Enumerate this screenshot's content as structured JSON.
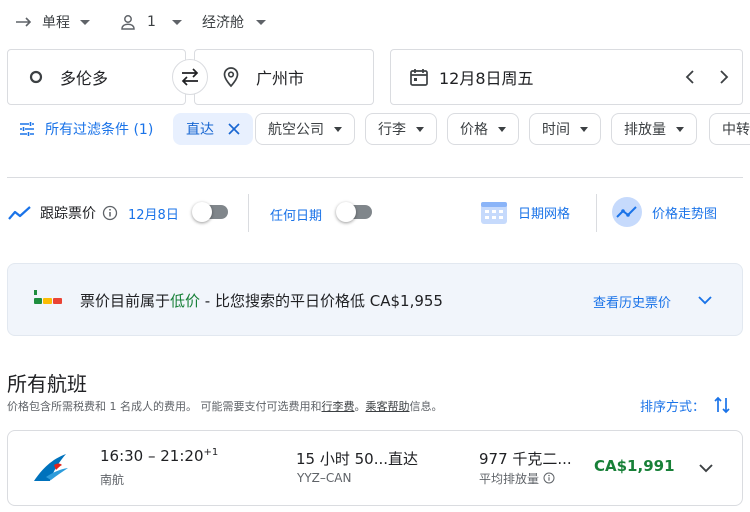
{
  "trip_options": {
    "trip_type": "单程",
    "passengers": "1",
    "cabin": "经济舱"
  },
  "search": {
    "origin": "多伦多",
    "destination": "广州市",
    "date": "12月8日周五"
  },
  "filters": {
    "all_filters": "所有过滤条件 (1)",
    "active_chip": "直达",
    "chips": [
      "航空公司",
      "行李",
      "价格",
      "时间",
      "排放量",
      "中转"
    ]
  },
  "tracking": {
    "track_label": "跟踪票价",
    "track_date": "12月8日",
    "any_date": "任何日期",
    "date_grid": "日期网格",
    "price_graph": "价格走势图"
  },
  "insight": {
    "prefix": "票价目前属于",
    "level": "低价",
    "suffix": " - 比您搜索的平日价格低 CA$1,955",
    "history_link": "查看历史票价"
  },
  "results": {
    "title": "所有航班",
    "subtitle_part1": "价格包含所需税费和 1 名成人的费用。 可能需要支付可选费用和",
    "subtitle_link1": "行李费",
    "subtitle_part2": "。",
    "subtitle_link2": "乘客帮助",
    "subtitle_part3": "信息。",
    "sort_label": "排序方式："
  },
  "flights": [
    {
      "times": "16:30 – 21:20",
      "day_offset": "+1",
      "airline": "南航",
      "duration": "15 小时 50...",
      "stops": "直达",
      "route": "YYZ–CAN",
      "emissions": "977 千克二...",
      "emissions_label": "平均排放量",
      "price": "CA$1,991"
    }
  ],
  "colors": {
    "accent": "#1a73e8",
    "price_green": "#188038",
    "chip_active_bg": "#e8f0fe",
    "airline_blue": "#0072bc",
    "airline_red": "#e2231a"
  }
}
